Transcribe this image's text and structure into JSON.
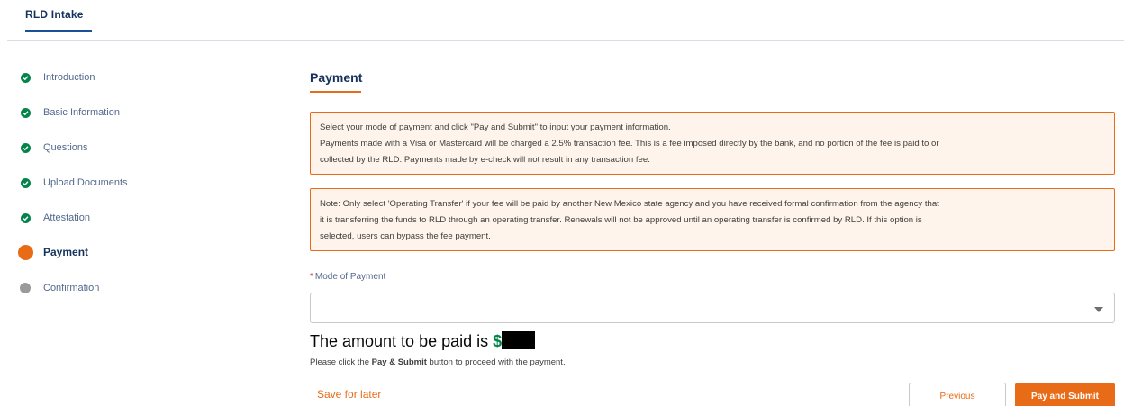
{
  "app": {
    "tab_label": "RLD Intake"
  },
  "steps": [
    {
      "label": "Introduction",
      "state": "complete"
    },
    {
      "label": "Basic Information",
      "state": "complete"
    },
    {
      "label": "Questions",
      "state": "complete"
    },
    {
      "label": "Upload Documents",
      "state": "complete"
    },
    {
      "label": "Attestation",
      "state": "complete"
    },
    {
      "label": "Payment",
      "state": "current"
    },
    {
      "label": "Confirmation",
      "state": "future"
    }
  ],
  "section": {
    "title": "Payment"
  },
  "notices": {
    "payment_info": [
      "Select your mode of payment and click \"Pay and Submit\" to input your payment information.",
      "Payments made with a Visa or Mastercard will be charged a 2.5% transaction fee. This is a fee imposed directly by the bank, and no portion of the fee is paid to or",
      "collected by the RLD. Payments made by e-check will not result in any transaction fee."
    ],
    "operating_transfer": [
      "Note: Only select 'Operating Transfer' if your fee will be paid by another New Mexico state agency and you have received formal confirmation from the agency that",
      "it is transferring the funds to RLD through an operating transfer. Renewals will not be approved until an operating transfer is confirmed by RLD. If this option is",
      "selected, users can bypass the fee payment."
    ]
  },
  "form": {
    "mode_of_payment": {
      "required_marker": "*",
      "label": "Mode of Payment",
      "value": ""
    }
  },
  "amount": {
    "prefix": "The amount to be paid is ",
    "currency": "$"
  },
  "instruction": {
    "before": "Please click the ",
    "bold": "Pay & Submit",
    "after": " button to proceed with the payment."
  },
  "actions": {
    "save_for_later": "Save for later",
    "previous": "Previous",
    "pay_and_submit": "Pay and Submit"
  },
  "colors": {
    "accent": "#e86b18",
    "complete": "#04844b",
    "future": "#9a9a9a",
    "notice_bg": "#fef4ec"
  }
}
